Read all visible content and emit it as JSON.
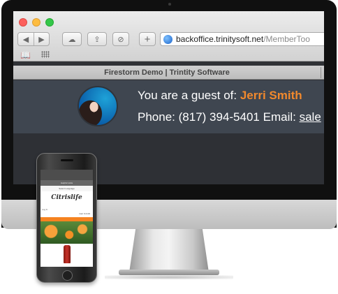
{
  "browser": {
    "url_host": "backoffice.trinitysoft.net",
    "url_path": "/MemberToo",
    "tab_title": "Firestorm Demo | Trintity Software",
    "icons": {
      "back": "chevron-left-icon",
      "forward": "chevron-right-icon",
      "cloud": "cloud-icon",
      "share": "share-icon",
      "block": "block-icon",
      "new_tab": "plus-icon",
      "bookmarks": "book-icon",
      "top_sites": "grid-icon"
    }
  },
  "page": {
    "guest_prefix": "You are a guest of:",
    "guest_name": "Jerri Smith",
    "phone_label": "Phone:",
    "phone_number": "(817) 394-5401",
    "email_label": "Email:",
    "email_value": "sale"
  },
  "mobile": {
    "helpful_links": "Helpful Links",
    "select_language": "Select Language",
    "logo": "Citrislife",
    "login_text": "Log In",
    "cart_text": "Cart: $ 0.00"
  },
  "colors": {
    "accent": "#f1892d",
    "header_bg": "#3f4650",
    "mobile_accent": "#f58220"
  }
}
